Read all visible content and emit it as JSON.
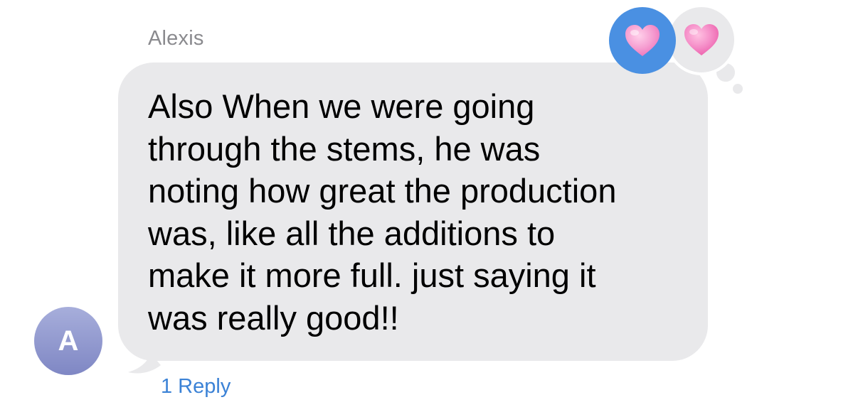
{
  "message": {
    "sender_name": "Alexis",
    "avatar_initial": "A",
    "text_lines": [
      "Also When we were going",
      "through the stems, he was",
      "noting how great the production",
      "was, like all the additions to",
      "make it more full. just saying it",
      "was really good!!"
    ],
    "reply_label": "1 Reply"
  },
  "tapbacks": [
    {
      "icon": "heart-icon",
      "owner": "me",
      "background": "#4a90e2"
    },
    {
      "icon": "heart-icon",
      "owner": "other",
      "background": "#e9e9eb"
    }
  ],
  "colors": {
    "bubble": "#e9e9eb",
    "link": "#3b82d6",
    "heart": "#f47fbf"
  }
}
